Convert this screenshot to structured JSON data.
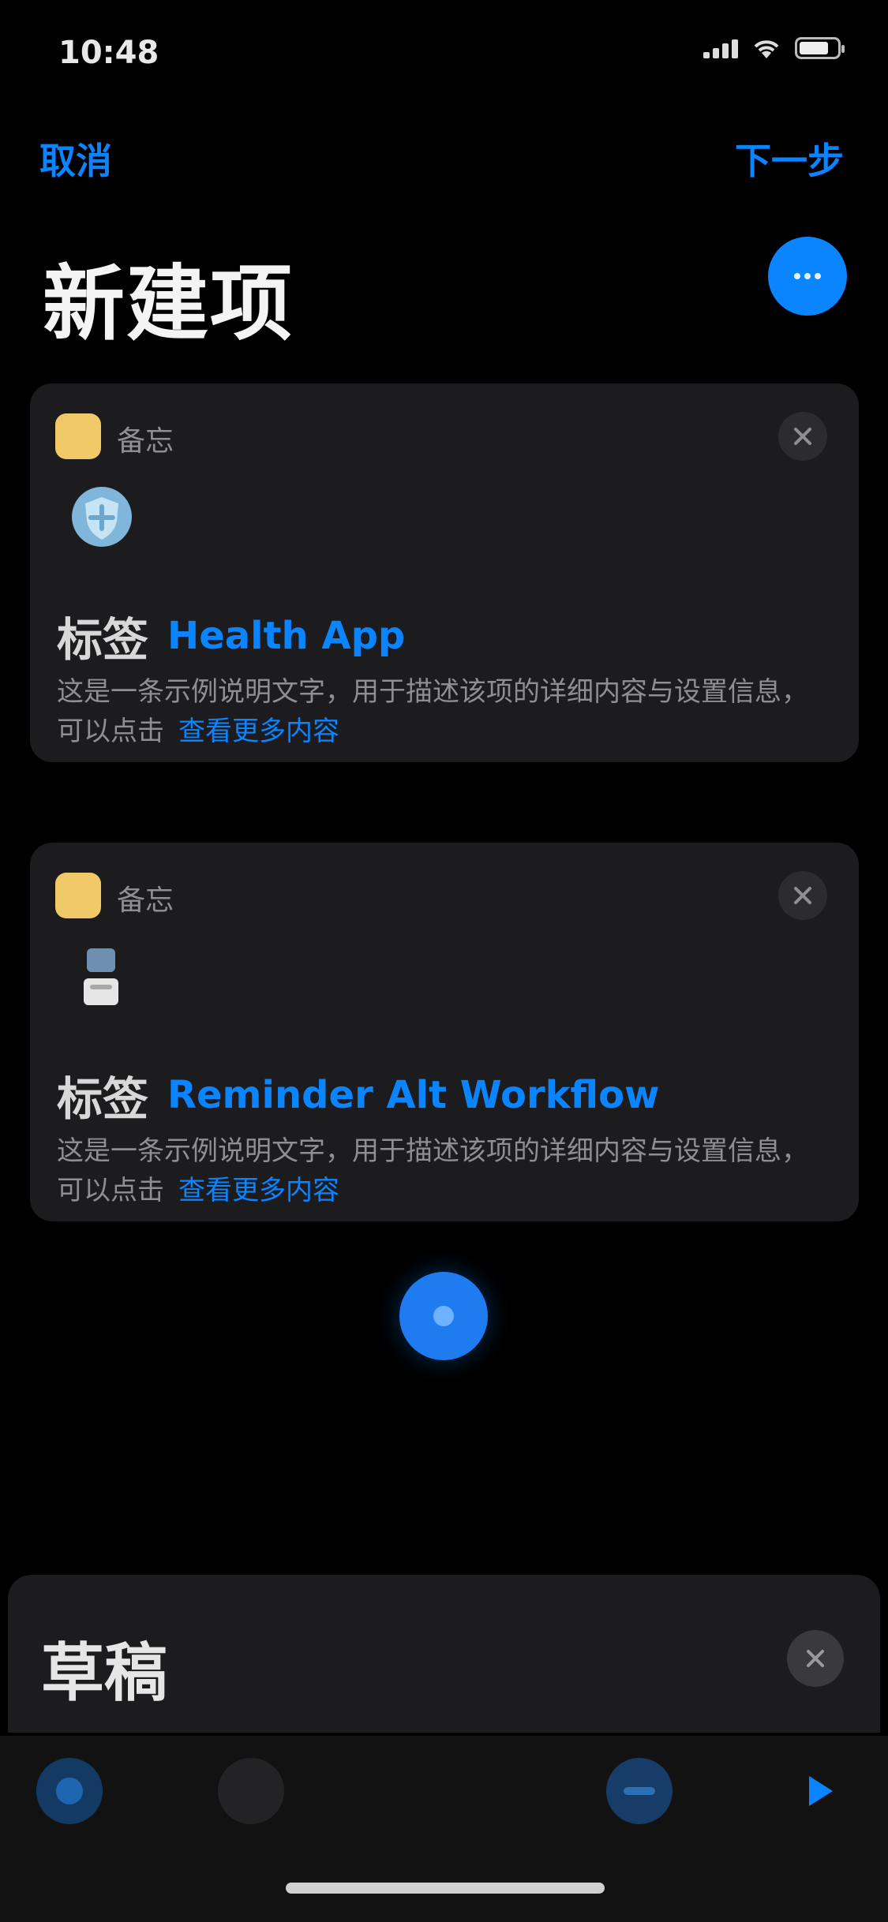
{
  "status_bar": {
    "time": "10:48"
  },
  "nav": {
    "left_label": "取消",
    "right_label": "下一步"
  },
  "page": {
    "title": "新建项"
  },
  "cards": [
    {
      "app_name": "备忘",
      "label": "标签",
      "title": "Health App",
      "description": "这是一条示例说明文字，用于描述该项的详细内容与设置信息，可以点击",
      "more": "查看更多内容"
    },
    {
      "app_name": "备忘",
      "label": "标签",
      "title": "Reminder Alt Workflow",
      "description": "这是一条示例说明文字，用于描述该项的详细内容与设置信息，可以点击",
      "more": "查看更多内容"
    }
  ],
  "bottom_panel": {
    "title": "草稿"
  },
  "colors": {
    "accent": "#0a84ff",
    "card_bg": "#1c1c1e",
    "background": "#000000"
  }
}
